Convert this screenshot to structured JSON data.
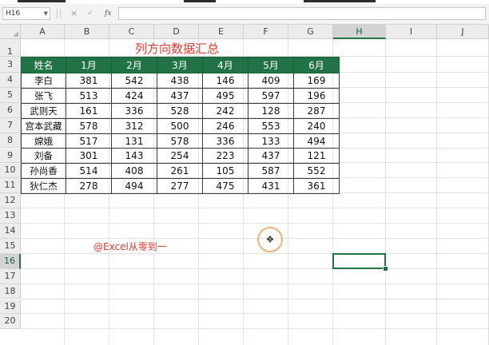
{
  "formula_bar": {
    "name_box": "H16",
    "cancel_icon": "×",
    "enter_icon": "✓",
    "fx_label": "fx",
    "formula": ""
  },
  "columns": [
    "A",
    "B",
    "C",
    "D",
    "E",
    "F",
    "G",
    "H",
    "I",
    "J"
  ],
  "rows": [
    "1",
    "3",
    "4",
    "5",
    "6",
    "7",
    "8",
    "9",
    "10",
    "11",
    "12",
    "13",
    "14",
    "15",
    "16",
    "17",
    "18",
    "19",
    "20"
  ],
  "active_cell": {
    "column": "H",
    "row": "16"
  },
  "sheet": {
    "title": "列方向数据汇总",
    "headers": [
      "姓名",
      "1月",
      "2月",
      "3月",
      "4月",
      "5月",
      "6月"
    ],
    "records": [
      {
        "name": "李白",
        "values": [
          "381",
          "542",
          "438",
          "146",
          "409",
          "169"
        ]
      },
      {
        "name": "张飞",
        "values": [
          "513",
          "424",
          "437",
          "495",
          "597",
          "196"
        ]
      },
      {
        "name": "武则天",
        "values": [
          "161",
          "336",
          "528",
          "242",
          "128",
          "287"
        ]
      },
      {
        "name": "宫本武藏",
        "values": [
          "578",
          "312",
          "500",
          "246",
          "553",
          "240"
        ]
      },
      {
        "name": "嫦娥",
        "values": [
          "517",
          "131",
          "578",
          "336",
          "133",
          "494"
        ]
      },
      {
        "name": "刘备",
        "values": [
          "301",
          "143",
          "254",
          "223",
          "437",
          "121"
        ]
      },
      {
        "name": "孙尚香",
        "values": [
          "514",
          "408",
          "261",
          "105",
          "587",
          "552"
        ]
      },
      {
        "name": "狄仁杰",
        "values": [
          "278",
          "494",
          "277",
          "475",
          "431",
          "361"
        ]
      }
    ],
    "watermark": "@Excel从零到一"
  },
  "colors": {
    "header_fill": "#217346",
    "title_text": "#e23b2e",
    "selection": "#217346"
  },
  "cursor_icon": "move-cursor-icon"
}
